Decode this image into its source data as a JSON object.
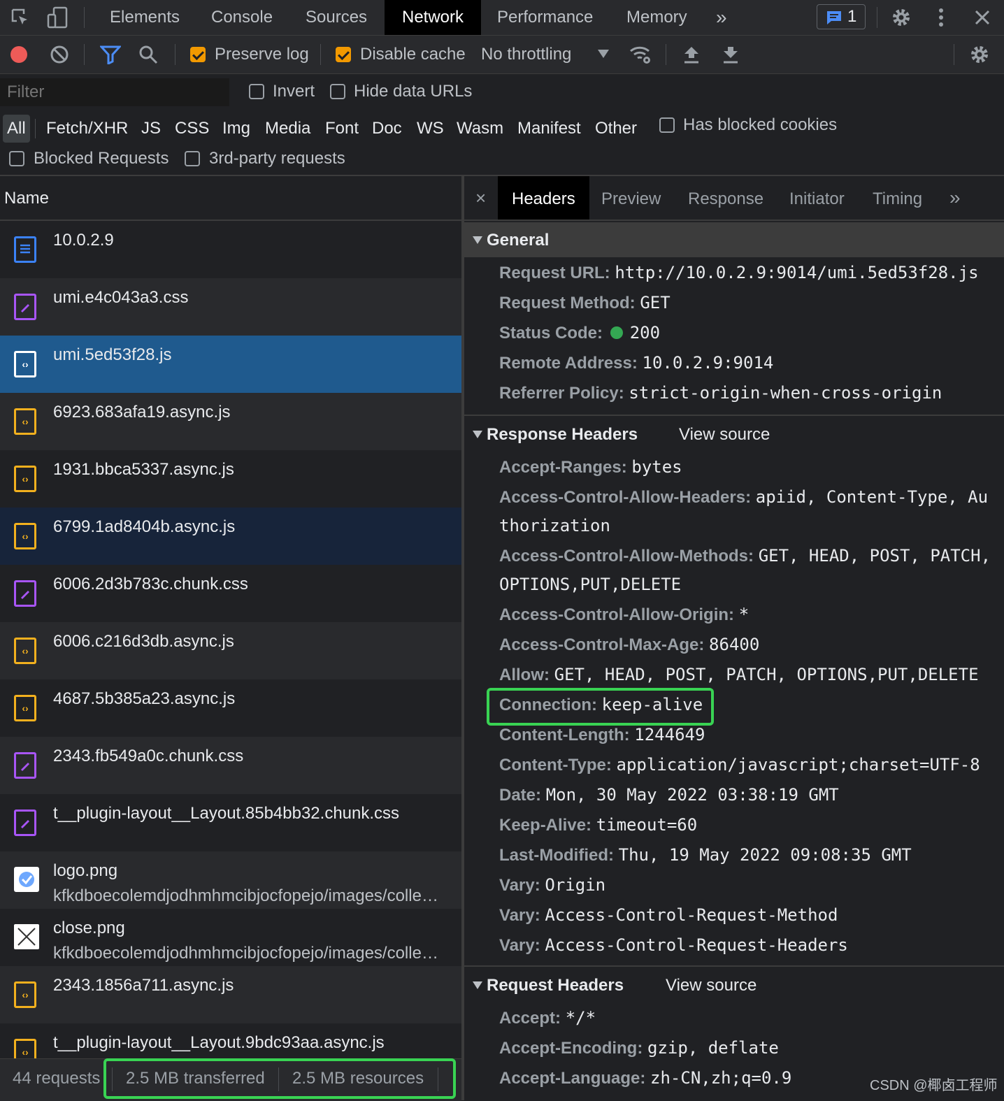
{
  "top_tabs": [
    "Elements",
    "Console",
    "Sources",
    "Network",
    "Performance",
    "Memory"
  ],
  "active_tab": "Network",
  "issues_count": "1",
  "toolbar": {
    "preserve_log": "Preserve log",
    "disable_cache": "Disable cache",
    "throttling": "No throttling",
    "preserve_log_checked": true,
    "disable_cache_checked": true
  },
  "filter": {
    "placeholder": "Filter",
    "invert": "Invert",
    "hide_data_urls": "Hide data URLs",
    "types": [
      "All",
      "Fetch/XHR",
      "JS",
      "CSS",
      "Img",
      "Media",
      "Font",
      "Doc",
      "WS",
      "Wasm",
      "Manifest",
      "Other"
    ],
    "has_blocked_cookies": "Has blocked cookies",
    "blocked_requests": "Blocked Requests",
    "third_party": "3rd-party requests"
  },
  "list": {
    "header": "Name",
    "items": [
      {
        "name": "10.0.2.9",
        "sub": "",
        "type": "doc"
      },
      {
        "name": "umi.e4c043a3.css",
        "sub": "",
        "type": "css"
      },
      {
        "name": "umi.5ed53f28.js",
        "sub": "",
        "type": "js",
        "selected": true
      },
      {
        "name": "6923.683afa19.async.js",
        "sub": "",
        "type": "js"
      },
      {
        "name": "1931.bbca5337.async.js",
        "sub": "",
        "type": "js"
      },
      {
        "name": "6799.1ad8404b.async.js",
        "sub": "",
        "type": "js",
        "hover": true
      },
      {
        "name": "6006.2d3b783c.chunk.css",
        "sub": "",
        "type": "css"
      },
      {
        "name": "6006.c216d3db.async.js",
        "sub": "",
        "type": "js"
      },
      {
        "name": "4687.5b385a23.async.js",
        "sub": "",
        "type": "js"
      },
      {
        "name": "2343.fb549a0c.chunk.css",
        "sub": "",
        "type": "css"
      },
      {
        "name": "t__plugin-layout__Layout.85b4bb32.chunk.css",
        "sub": "",
        "type": "css"
      },
      {
        "name": "logo.png",
        "sub": "kfkdboecolemdjodhmhmcibjocfopejo/images/colle…",
        "type": "img"
      },
      {
        "name": "close.png",
        "sub": "kfkdboecolemdjodhmhmcibjocfopejo/images/colle…",
        "type": "close"
      },
      {
        "name": "2343.1856a711.async.js",
        "sub": "",
        "type": "js"
      },
      {
        "name": "t__plugin-layout__Layout.9bdc93aa.async.js",
        "sub": "",
        "type": "js"
      }
    ]
  },
  "status": {
    "requests": "44 requests",
    "transferred": "2.5 MB transferred",
    "resources": "2.5 MB resources"
  },
  "detail_tabs": [
    "Headers",
    "Preview",
    "Response",
    "Initiator",
    "Timing"
  ],
  "detail_active": "Headers",
  "general": {
    "title": "General",
    "rows": [
      {
        "k": "Request URL:",
        "v": "http://10.0.2.9:9014/umi.5ed53f28.js"
      },
      {
        "k": "Request Method:",
        "v": "GET"
      },
      {
        "k": "Status Code:",
        "v": "200"
      },
      {
        "k": "Remote Address:",
        "v": "10.0.2.9:9014"
      },
      {
        "k": "Referrer Policy:",
        "v": "strict-origin-when-cross-origin"
      }
    ]
  },
  "response_headers": {
    "title": "Response Headers",
    "view_source": "View source",
    "rows": [
      {
        "k": "Accept-Ranges:",
        "v": "bytes"
      },
      {
        "k": "Access-Control-Allow-Headers:",
        "v": "apiid, Content-Type, Au",
        "v2": "thorization"
      },
      {
        "k": "Access-Control-Allow-Methods:",
        "v": "GET, HEAD, POST, PATCH,",
        "v2": "OPTIONS,PUT,DELETE"
      },
      {
        "k": "Access-Control-Allow-Origin:",
        "v": "*"
      },
      {
        "k": "Access-Control-Max-Age:",
        "v": "86400"
      },
      {
        "k": "Allow:",
        "v": "GET, HEAD, POST, PATCH, OPTIONS,PUT,DELETE"
      },
      {
        "k": "Connection:",
        "v": "keep-alive"
      },
      {
        "k": "Content-Length:",
        "v": "1244649"
      },
      {
        "k": "Content-Type:",
        "v": "application/javascript;charset=UTF-8"
      },
      {
        "k": "Date:",
        "v": "Mon, 30 May 2022 03:38:19 GMT"
      },
      {
        "k": "Keep-Alive:",
        "v": "timeout=60"
      },
      {
        "k": "Last-Modified:",
        "v": "Thu, 19 May 2022 09:08:35 GMT"
      },
      {
        "k": "Vary:",
        "v": "Origin"
      },
      {
        "k": "Vary:",
        "v": "Access-Control-Request-Method"
      },
      {
        "k": "Vary:",
        "v": "Access-Control-Request-Headers"
      }
    ]
  },
  "request_headers": {
    "title": "Request Headers",
    "view_source": "View source",
    "rows": [
      {
        "k": "Accept:",
        "v": "*/*"
      },
      {
        "k": "Accept-Encoding:",
        "v": "gzip, deflate"
      },
      {
        "k": "Accept-Language:",
        "v": "zh-CN,zh;q=0.9"
      }
    ]
  },
  "watermark": "CSDN @椰卤工程师",
  "colors": {
    "highlight_box": "#39d353",
    "selected_row": "#1f5a8e",
    "status_ok": "#34a853"
  }
}
